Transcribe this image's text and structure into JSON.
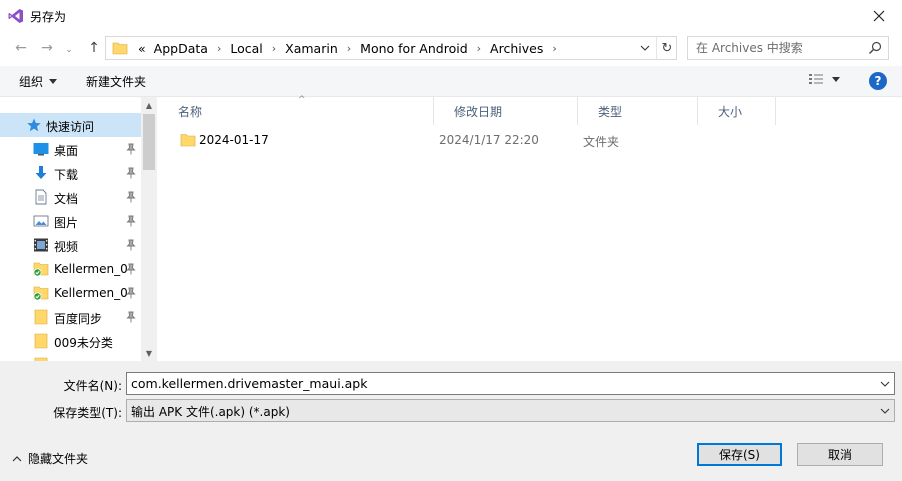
{
  "window": {
    "title": "另存为"
  },
  "navigation": {
    "breadcrumb_overflow": "«",
    "breadcrumbs": [
      "AppData",
      "Local",
      "Xamarin",
      "Mono for Android",
      "Archives"
    ],
    "search_placeholder": "在 Archives 中搜索"
  },
  "toolbar": {
    "organize_label": "组织",
    "new_folder_label": "新建文件夹"
  },
  "sidebar": {
    "items": [
      {
        "label": "快速访问",
        "icon": "star-icon"
      },
      {
        "label": "桌面",
        "icon": "desktop-icon"
      },
      {
        "label": "下载",
        "icon": "download-icon"
      },
      {
        "label": "文档",
        "icon": "document-icon"
      },
      {
        "label": "图片",
        "icon": "pictures-icon"
      },
      {
        "label": "视频",
        "icon": "video-icon"
      },
      {
        "label": "Kellermen_0",
        "icon": "synced-folder-icon"
      },
      {
        "label": "Kellermen_0",
        "icon": "synced-folder-icon"
      },
      {
        "label": "百度同步",
        "icon": "folder-icon"
      },
      {
        "label": "009未分类",
        "icon": "folder-icon"
      }
    ]
  },
  "file_list": {
    "columns": [
      "名称",
      "修改日期",
      "类型",
      "大小"
    ],
    "rows": [
      {
        "name": "2024-01-17",
        "modified": "2024/1/17 22:20",
        "type": "文件夹",
        "size": ""
      }
    ]
  },
  "form": {
    "filename_label": "文件名(N):",
    "filename_value": "com.kellermen.drivemaster_maui.apk",
    "filetype_label": "保存类型(T):",
    "filetype_value": "输出 APK 文件(.apk) (*.apk)",
    "hide_folders_label": "隐藏文件夹",
    "save_label": "保存(S)",
    "cancel_label": "取消"
  },
  "colors": {
    "accent": "#0078d7",
    "selection": "#cce4f7",
    "folder": "#ffd76a",
    "help": "#1c68c7"
  }
}
